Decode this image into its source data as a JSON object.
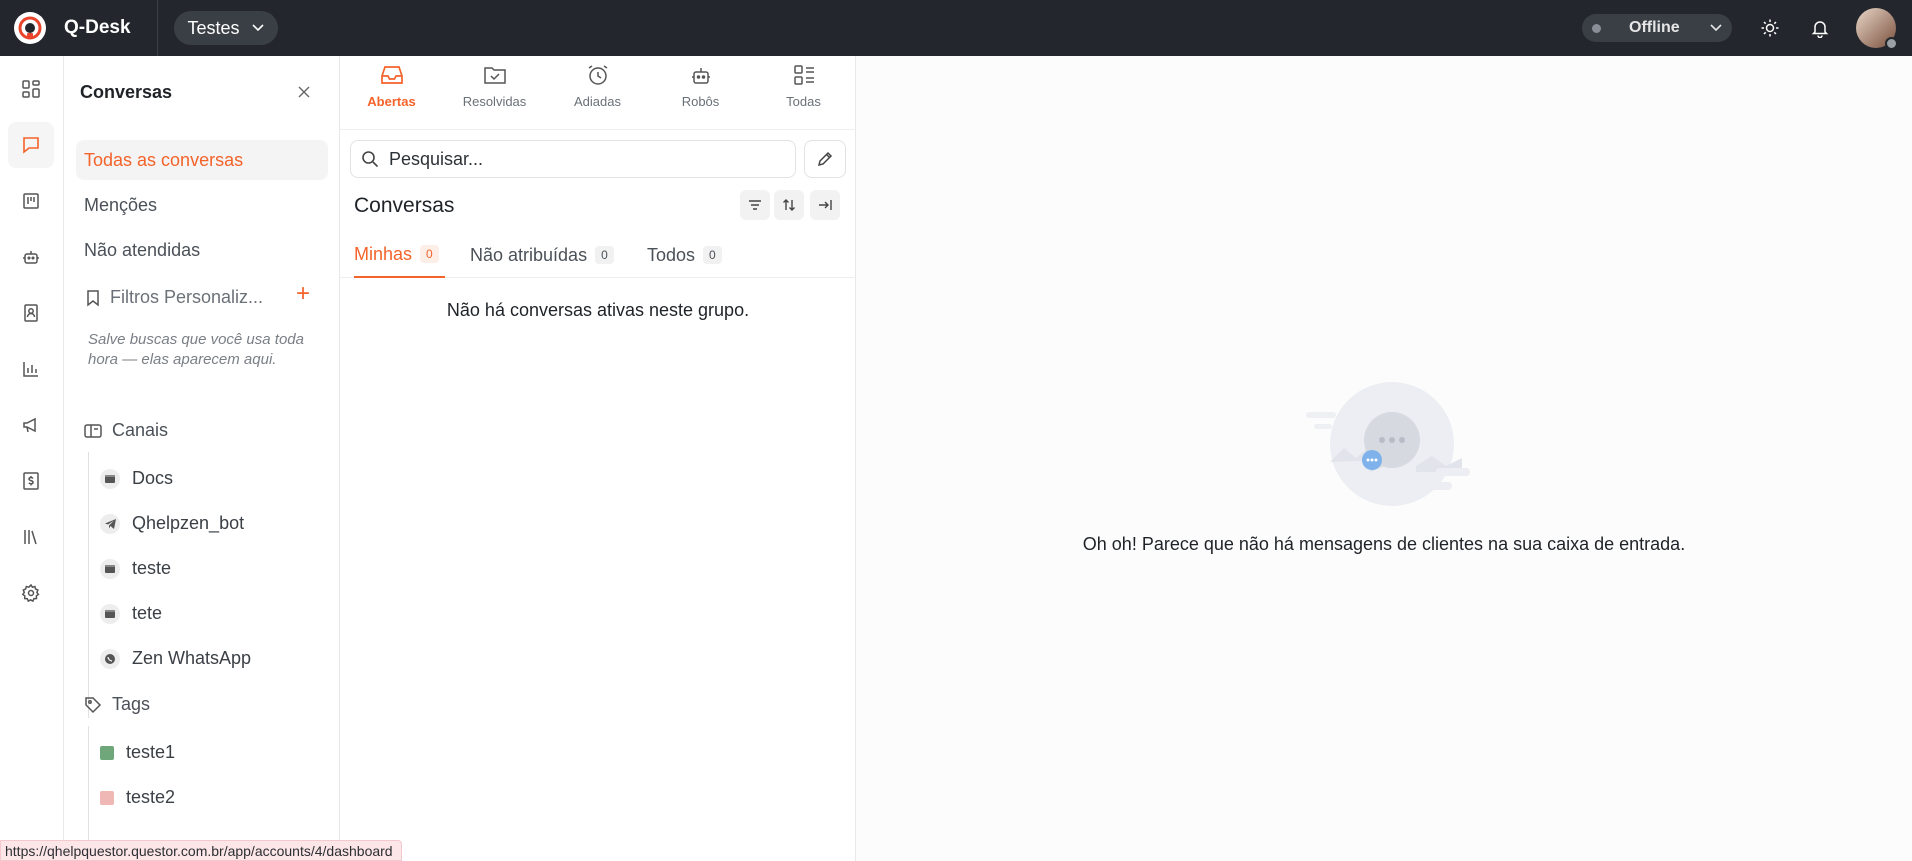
{
  "topbar": {
    "app_name": "Q-Desk",
    "workspace": "Testes",
    "status": "Offline"
  },
  "sidebar": {
    "title": "Conversas",
    "nav": [
      {
        "label": "Todas as conversas"
      },
      {
        "label": "Menções"
      },
      {
        "label": "Não atendidas"
      }
    ],
    "filters_label": "Filtros Personaliz...",
    "filters_hint": "Salve buscas que você usa toda hora — elas aparecem aqui.",
    "channels_label": "Canais",
    "channels": [
      {
        "label": "Docs",
        "icon": "web-widget-icon"
      },
      {
        "label": "Qhelpzen_bot",
        "icon": "telegram-icon"
      },
      {
        "label": "teste",
        "icon": "web-widget-icon"
      },
      {
        "label": "tete",
        "icon": "web-widget-icon"
      },
      {
        "label": "Zen WhatsApp",
        "icon": "whatsapp-icon"
      }
    ],
    "tags_label": "Tags",
    "tags": [
      {
        "label": "teste1",
        "color": "#6fa77b"
      },
      {
        "label": "teste2",
        "color": "#efb8b5"
      }
    ]
  },
  "panel": {
    "tabs": [
      {
        "label": "Abertas"
      },
      {
        "label": "Resolvidas"
      },
      {
        "label": "Adiadas"
      },
      {
        "label": "Robôs"
      },
      {
        "label": "Todas"
      }
    ],
    "search_placeholder": "Pesquisar...",
    "title": "Conversas",
    "subtabs": [
      {
        "label": "Minhas",
        "count": "0"
      },
      {
        "label": "Não atribuídas",
        "count": "0"
      },
      {
        "label": "Todos",
        "count": "0"
      }
    ],
    "empty": "Não há conversas ativas neste grupo."
  },
  "main": {
    "empty_message": "Oh oh! Parece que não há mensagens de clientes na sua caixa de entrada."
  },
  "status_url": "https://qhelpquestor.questor.com.br/app/accounts/4/dashboard",
  "colors": {
    "accent": "#f4632a",
    "topbar": "#23272d"
  }
}
